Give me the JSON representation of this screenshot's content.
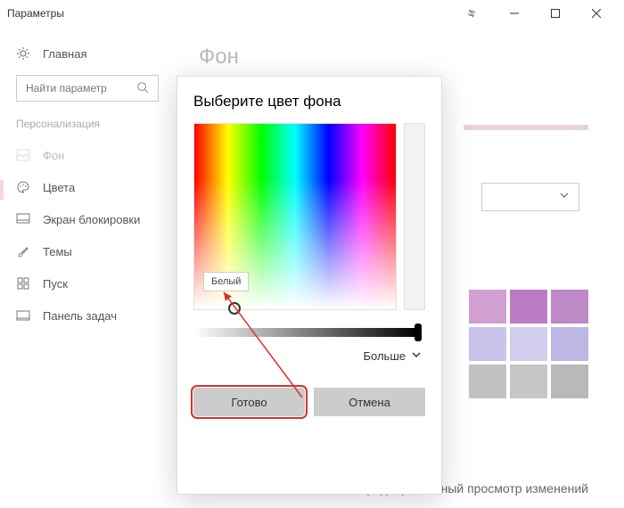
{
  "window": {
    "title": "Параметры"
  },
  "sidebar": {
    "search_placeholder": "Найти параметр",
    "home_label": "Главная",
    "category": "Персонализация",
    "items": [
      {
        "label": "Фон"
      },
      {
        "label": "Цвета"
      },
      {
        "label": "Экран блокировки"
      },
      {
        "label": "Темы"
      },
      {
        "label": "Пуск"
      },
      {
        "label": "Панель задач"
      }
    ]
  },
  "page": {
    "title": "Фон",
    "preview_label": "Предварительный просмотр изменений"
  },
  "swatches": [
    "#d19fd1",
    "#bb7cc4",
    "#be89c7",
    "#c9c2ea",
    "#d1cdee",
    "#bcb7e4",
    "#c2c2c2",
    "#c6c6c6",
    "#b9b9b9"
  ],
  "dialog": {
    "title": "Выберите цвет фона",
    "tooltip": "Белый",
    "more": "Больше",
    "done": "Готово",
    "cancel": "Отмена"
  }
}
